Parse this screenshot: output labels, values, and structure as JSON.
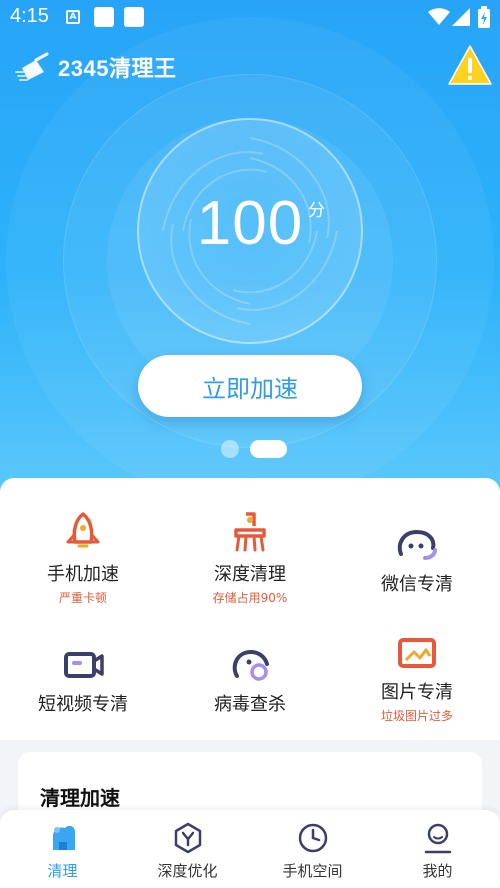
{
  "status_bar": {
    "time": "4:15",
    "a_label": "A"
  },
  "app": {
    "title": "2345清理王"
  },
  "score": {
    "value": "100",
    "unit": "分"
  },
  "action": {
    "label": "立即加速"
  },
  "tools": [
    {
      "label": "手机加速",
      "sub": "严重卡顿"
    },
    {
      "label": "深度清理",
      "sub": "存储占用90%"
    },
    {
      "label": "微信专清",
      "sub": ""
    },
    {
      "label": "短视频专清",
      "sub": ""
    },
    {
      "label": "病毒查杀",
      "sub": ""
    },
    {
      "label": "图片专清",
      "sub": "垃圾图片过多"
    }
  ],
  "card": {
    "title": "清理加速"
  },
  "tabs": [
    {
      "label": "清理",
      "active": true
    },
    {
      "label": "深度优化"
    },
    {
      "label": "手机空间"
    },
    {
      "label": "我的"
    }
  ],
  "colors": {
    "accent": "#2f9de8",
    "warning": "#e65a3b",
    "hero_top": "#27a4f7",
    "icon_dark": "#3c3f6b"
  }
}
